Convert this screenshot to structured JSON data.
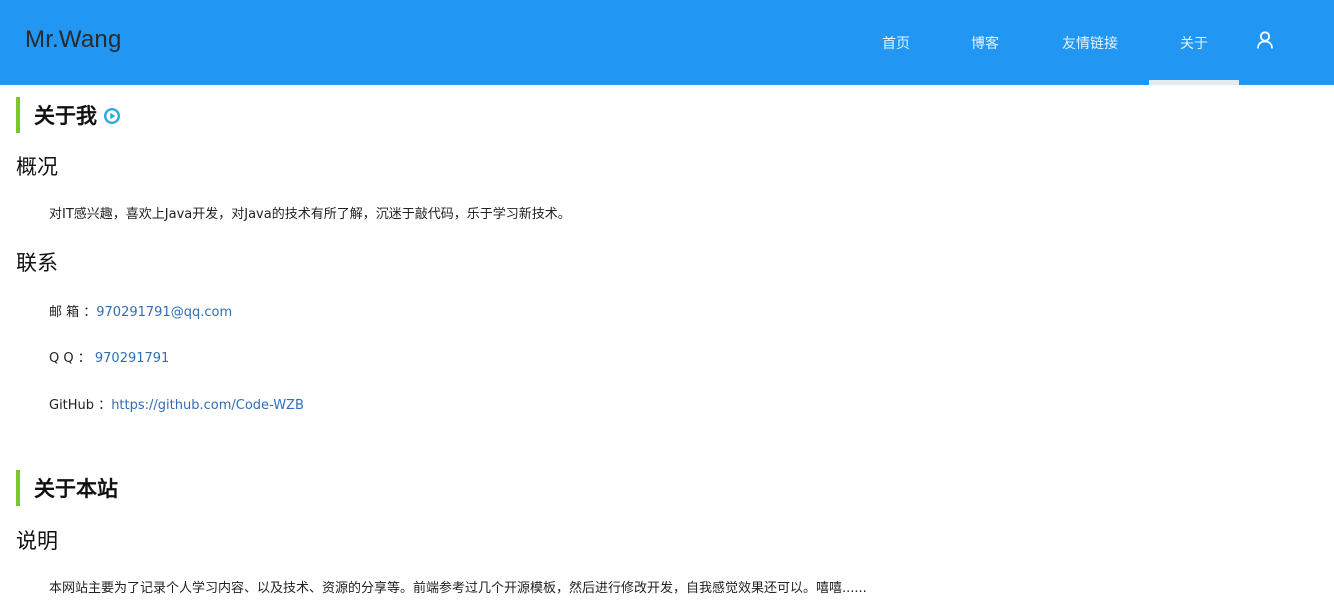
{
  "header": {
    "brand": "Mr.Wang",
    "nav": {
      "home": "首页",
      "blog": "博客",
      "links": "友情链接",
      "about": "关于"
    },
    "active_item": "关于",
    "user_icon": "user-icon"
  },
  "about_me": {
    "title": "关于我",
    "title_icon": "play-circle-icon",
    "overview_heading": "概况",
    "overview_text": "对IT感兴趣，喜欢上Java开发，对Java的技术有所了解，沉迷于敲代码，乐于学习新技术。",
    "contact_heading": "联系",
    "contacts": {
      "email_label": "邮 箱 ：",
      "email_value": "970291791@qq.com",
      "qq_label": "Q Q ： ",
      "qq_value": "970291791",
      "github_label": "GitHub ：",
      "github_value": "https://github.com/Code-WZB"
    }
  },
  "about_site": {
    "title": "关于本站",
    "desc_heading": "说明",
    "desc_text": "本网站主要为了记录个人学习内容、以及技术、资源的分享等。前端参考过几个开源模板，然后进行修改开发，自我感觉效果还可以。嘻嘻......"
  },
  "colors": {
    "header_bg": "#2196f3",
    "accent_bar": "#7cc62b",
    "link": "#2f6fb7",
    "play_icon": "#29a8e0"
  }
}
